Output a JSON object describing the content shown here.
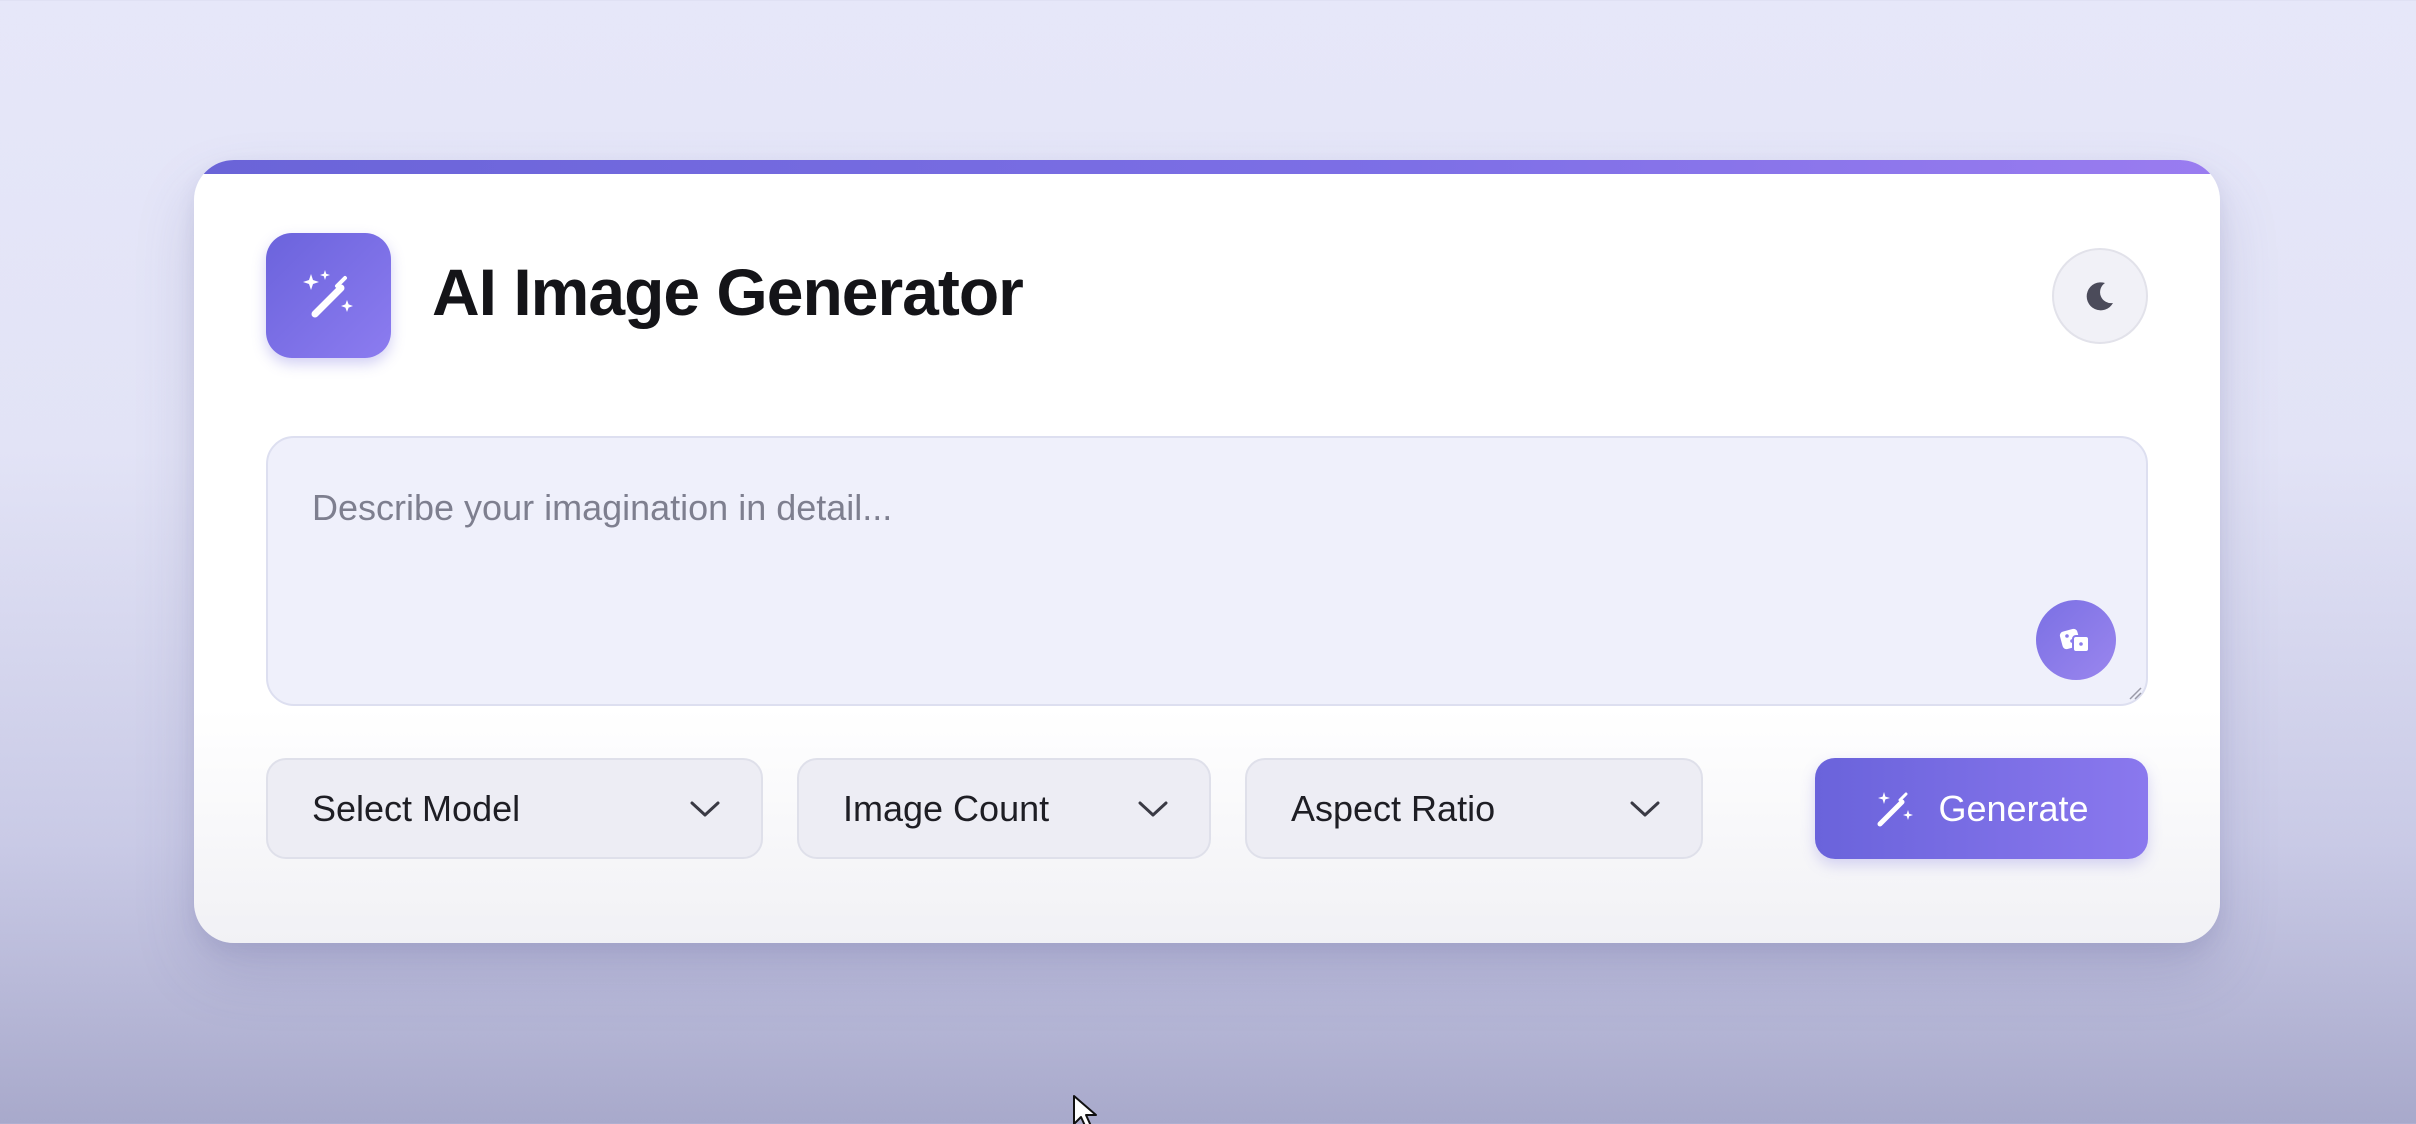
{
  "app": {
    "title": "AI Image Generator",
    "logo_icon": "magic-wand-sparkles-icon",
    "theme_toggle_icon": "moon-icon"
  },
  "prompt": {
    "placeholder": "Describe your imagination in detail...",
    "value": "",
    "random_button_icon": "dice-icon"
  },
  "controls": {
    "model_select": {
      "label": "Select Model",
      "icon": "chevron-down-icon"
    },
    "count_select": {
      "label": "Image Count",
      "icon": "chevron-down-icon"
    },
    "ratio_select": {
      "label": "Aspect Ratio",
      "icon": "chevron-down-icon"
    },
    "generate_button": {
      "label": "Generate",
      "icon": "magic-wand-icon"
    }
  },
  "colors": {
    "accent_start": "#6a63db",
    "accent_end": "#8a78ee",
    "page_bg_top": "#e6e7f9",
    "page_bg_bottom": "#a8a9cb"
  }
}
